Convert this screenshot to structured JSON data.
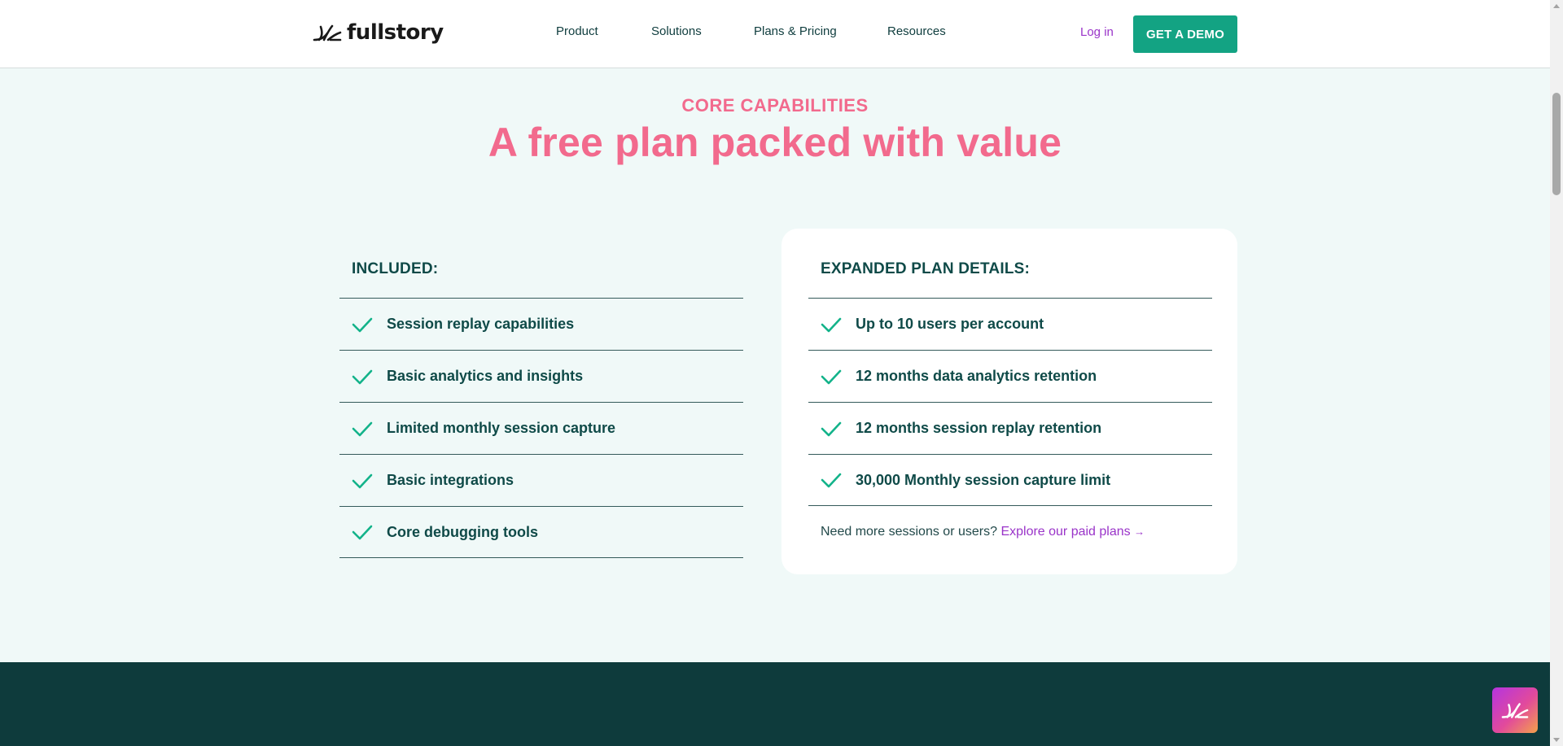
{
  "header": {
    "logo_text": "fullstory",
    "nav": [
      "Product",
      "Solutions",
      "Plans & Pricing",
      "Resources"
    ],
    "login_label": "Log in",
    "demo_label": "GET A DEMO"
  },
  "hero": {
    "eyebrow": "CORE CAPABILITIES",
    "headline": "A free plan packed with value"
  },
  "included": {
    "title": "INCLUDED:",
    "items": [
      "Session replay capabilities",
      "Basic analytics and insights",
      "Limited monthly session capture",
      "Basic integrations",
      "Core debugging tools"
    ]
  },
  "expanded": {
    "title": "EXPANDED PLAN DETAILS:",
    "items": [
      "Up to 10 users per account",
      "12 months data analytics retention",
      "12 months session replay retention",
      "30,000 Monthly session capture limit"
    ],
    "note_text": "Need more sessions or users?",
    "note_link": "Explore our paid plans",
    "note_arrow": "→"
  },
  "colors": {
    "accent_pink": "#f26a8d",
    "brand_green": "#13a383",
    "link_purple": "#9a34c9",
    "dark_teal": "#0e3b3c",
    "page_bg": "#f0f9f8"
  },
  "icons": {
    "logo": "fullstory-burst-icon",
    "check": "check-icon",
    "chat": "fullstory-chat-icon"
  }
}
